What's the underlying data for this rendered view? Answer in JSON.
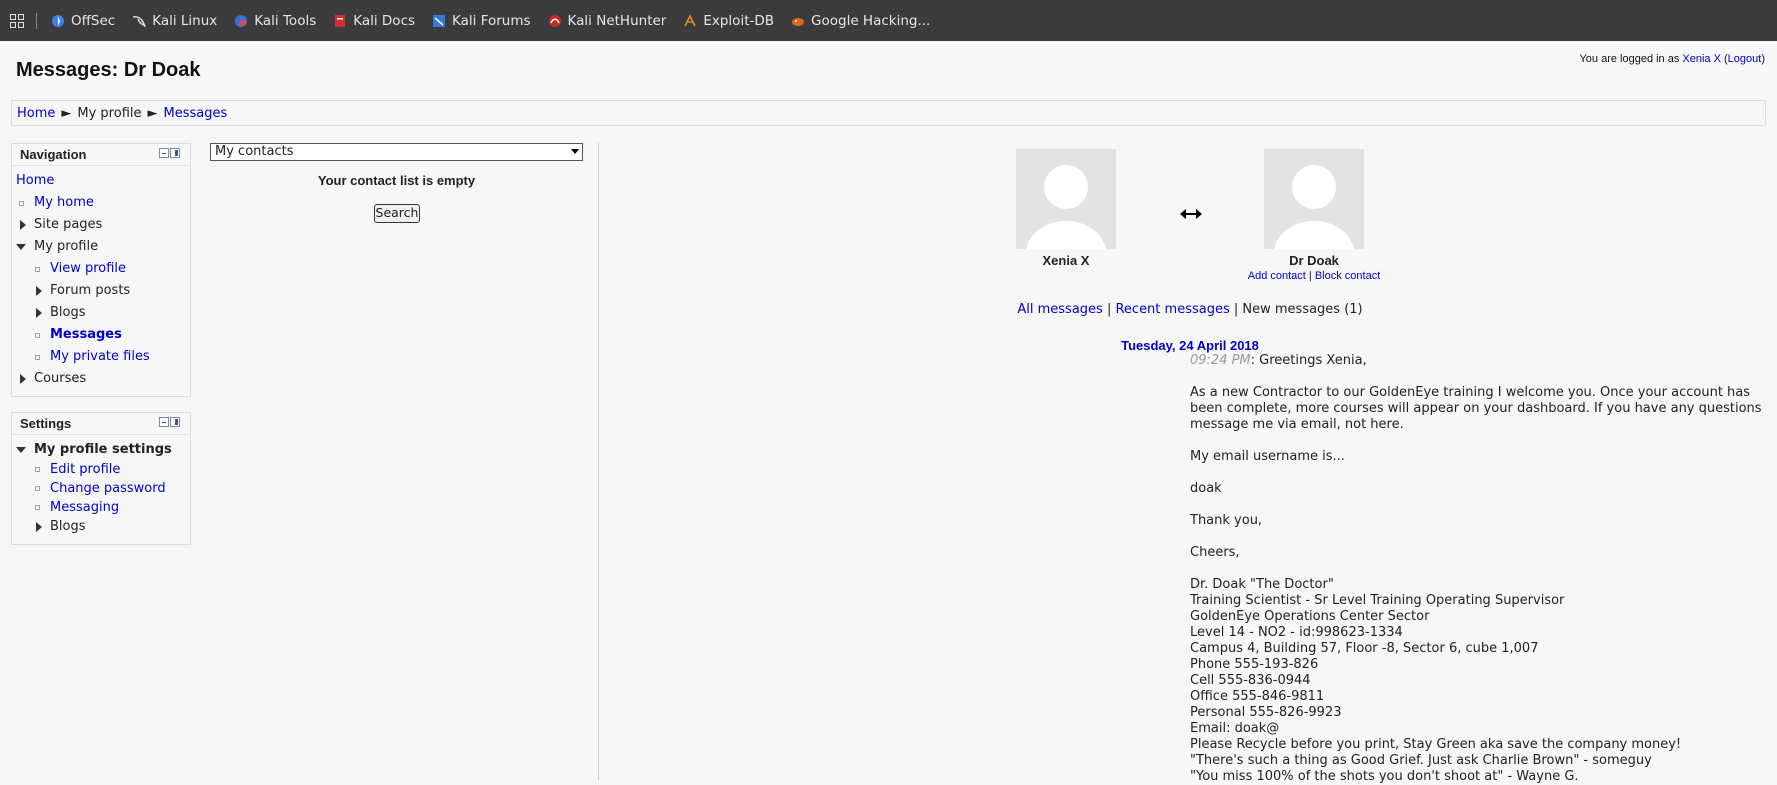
{
  "bookmarks": [
    {
      "label": "OffSec",
      "icon": "offsec-icon"
    },
    {
      "label": "Kali Linux",
      "icon": "kali-dragon-icon"
    },
    {
      "label": "Kali Tools",
      "icon": "kali-tools-icon"
    },
    {
      "label": "Kali Docs",
      "icon": "kali-docs-icon"
    },
    {
      "label": "Kali Forums",
      "icon": "kali-forums-icon"
    },
    {
      "label": "Kali NetHunter",
      "icon": "nethunter-icon"
    },
    {
      "label": "Exploit-DB",
      "icon": "exploit-db-icon"
    },
    {
      "label": "Google Hacking...",
      "icon": "ghdb-icon"
    }
  ],
  "header": {
    "login_prefix": "You are logged in as ",
    "login_user": "Xenia X",
    "logout_open": " (",
    "logout_label": "Logout",
    "logout_close": ")",
    "page_title": "Messages: Dr Doak"
  },
  "breadcrumb": {
    "home": "Home",
    "sep": "►",
    "profile": "My profile",
    "messages": "Messages"
  },
  "navigation": {
    "title": "Navigation",
    "home": "Home",
    "my_home": "My home",
    "site_pages": "Site pages",
    "my_profile": "My profile",
    "view_profile": "View profile",
    "forum_posts": "Forum posts",
    "blogs": "Blogs",
    "messages": "Messages",
    "private_files": "My private files",
    "courses": "Courses"
  },
  "settings": {
    "title": "Settings",
    "section": "My profile settings",
    "edit_profile": "Edit profile",
    "change_password": "Change password",
    "messaging": "Messaging",
    "blogs": "Blogs"
  },
  "contacts": {
    "selected": "My contacts",
    "empty": "Your contact list is empty",
    "search": "Search"
  },
  "conversation": {
    "user1": "Xenia X",
    "user2": "Dr Doak",
    "add_contact": "Add contact",
    "block_contact": "Block contact",
    "link_sep": " | ",
    "all_messages": "All messages",
    "recent_messages": "Recent messages",
    "new_messages": "New messages (1)",
    "date": "Tuesday, 24 April 2018",
    "time": "09:24 PM",
    "greeting": ": Greetings Xenia,",
    "lines": [
      "",
      "As a new Contractor to our GoldenEye training I welcome you. Once your account has been complete, more courses will appear on your dashboard. If you have any questions message me via email, not here.",
      "",
      "My email username is...",
      "",
      "doak",
      "",
      "Thank you,",
      "",
      "Cheers,",
      "",
      "Dr. Doak \"The Doctor\"",
      "Training Scientist - Sr Level Training Operating Supervisor",
      "GoldenEye Operations Center Sector",
      "Level 14 - NO2 - id:998623-1334",
      "Campus 4, Building 57, Floor -8, Sector 6, cube 1,007",
      "Phone 555-193-826",
      "Cell 555-836-0944",
      "Office 555-846-9811",
      "Personal 555-826-9923",
      "Email: doak@",
      "Please Recycle before you print, Stay Green aka save the company money!",
      "\"There's such a thing as Good Grief. Just ask Charlie Brown\" - someguy",
      "\"You miss 100% of the shots you don't shoot at\" - Wayne G."
    ]
  }
}
